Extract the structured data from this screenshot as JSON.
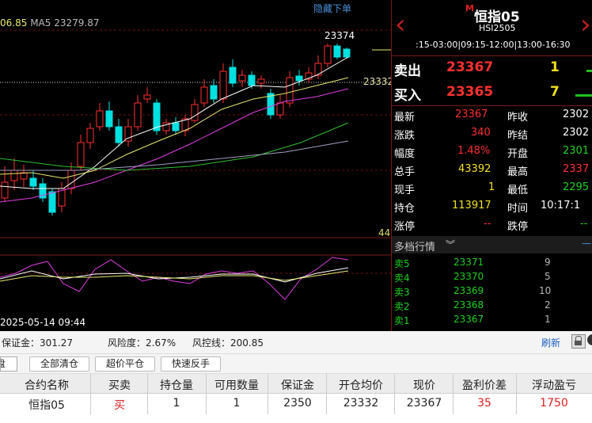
{
  "chart": {
    "ma_legend_cut": "06.85",
    "ma_legend_ma5": "MA5 23279.87",
    "hide_order": "隐藏下单",
    "high_annotation": "23374",
    "avg_price_tag": "23332",
    "small_tag": "44",
    "date_label": "2025-05-14 09:44",
    "colors": {
      "up": "#ff3030",
      "down": "#00e0e0",
      "ma5": "#ffffff",
      "ma10": "#e8e870",
      "ma20": "#e040e0",
      "ma60": "#30c030",
      "ma120": "#a0a0c0"
    }
  },
  "quote": {
    "m_badge": "M",
    "title": "恒指05",
    "code": "HSI2505",
    "session_times": ":15-03:00|09:15-12:00|13:00-16:30",
    "sell_label": "卖出",
    "sell_price": "23367",
    "sell_qty": "1",
    "buy_label": "买入",
    "buy_price": "23365",
    "buy_qty": "7",
    "stats": {
      "latest_label": "最新",
      "latest": "23367",
      "prev_close_label": "昨收",
      "prev_close": "2302",
      "change_label": "涨跌",
      "change": "340",
      "prev_settle_label": "昨结",
      "prev_settle": "2302",
      "amplitude_label": "幅度",
      "amplitude": "1.48%",
      "open_label": "开盘",
      "open": "2301",
      "volume_label": "总手",
      "volume": "43392",
      "high_label": "最高",
      "high": "2337",
      "last_vol_label": "现手",
      "last_vol": "1",
      "low_label": "最低",
      "low": "2295",
      "oi_label": "持仓",
      "oi": "113917",
      "time_label": "时间",
      "time": "10:17:1",
      "limit_up_label": "涨停",
      "limit_up": "--",
      "limit_down_label": "跌停",
      "limit_down": "--"
    },
    "depth_title": "多档行情",
    "depth": [
      {
        "label": "卖5",
        "price": "23371",
        "vol": "9"
      },
      {
        "label": "卖4",
        "price": "23370",
        "vol": "5"
      },
      {
        "label": "卖3",
        "price": "23369",
        "vol": "10"
      },
      {
        "label": "卖2",
        "price": "23368",
        "vol": "2"
      },
      {
        "label": "卖1",
        "price": "23367",
        "vol": "1"
      }
    ]
  },
  "account": {
    "margin": "保证金：301.27",
    "risk": "风险度：2.67%",
    "risk_line": "风控线：200.85",
    "refresh": "刷新"
  },
  "toolbar": {
    "tab_cut": "盘",
    "close_all": "全部清仓",
    "over_close": "超价平仓",
    "reverse": "快速反手"
  },
  "positions": {
    "headers": [
      "合约名称",
      "买卖",
      "持仓量",
      "可用数量",
      "保证金",
      "开仓均价",
      "现价",
      "盈利价差",
      "浮动盈亏"
    ],
    "rows": [
      [
        "恒指05",
        "买",
        "1",
        "1",
        "2350",
        "23332",
        "23367",
        "35",
        "1750"
      ]
    ]
  }
}
